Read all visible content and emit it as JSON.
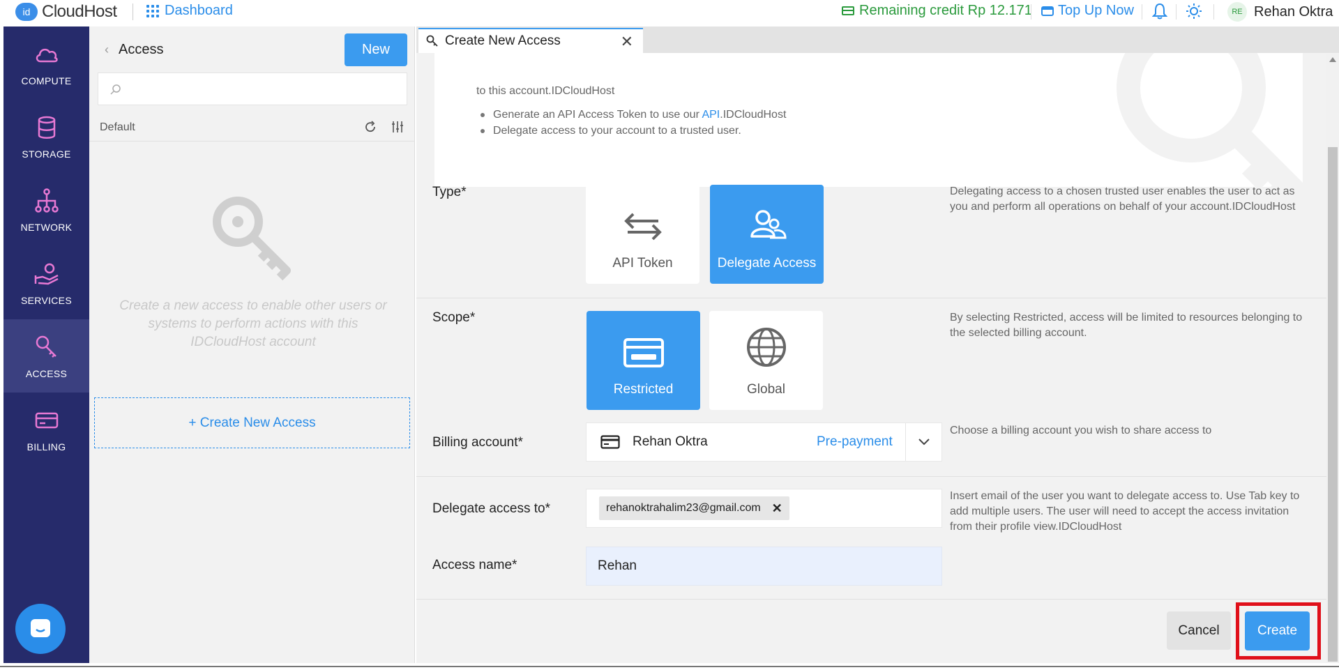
{
  "header": {
    "logo_badge": "id",
    "logo_text": "CloudHost",
    "dashboard_label": "Dashboard",
    "credit_label": "Remaining credit Rp 12.171",
    "topup_label": "Top Up Now",
    "user_initials": "RE",
    "user_name": "Rehan Oktra"
  },
  "sidebar": {
    "items": [
      {
        "label": "COMPUTE",
        "icon": "cloud-icon"
      },
      {
        "label": "STORAGE",
        "icon": "database-icon"
      },
      {
        "label": "NETWORK",
        "icon": "network-icon"
      },
      {
        "label": "SERVICES",
        "icon": "services-icon"
      },
      {
        "label": "ACCESS",
        "icon": "key-icon",
        "active": true
      },
      {
        "label": "BILLING",
        "icon": "card-icon"
      }
    ]
  },
  "left_panel": {
    "title": "Access",
    "new_button": "New",
    "search_placeholder": "",
    "group_label": "Default",
    "empty_text": "Create a new access to enable other users or systems to perform actions with this IDCloudHost account",
    "create_link": "+ Create New Access"
  },
  "tab": {
    "title": "Create New Access"
  },
  "info": {
    "line1": "to this account.IDCloudHost",
    "bullet1_prefix": "Generate an API Access Token to use our ",
    "bullet1_link": "API",
    "bullet1_suffix": ".IDCloudHost",
    "bullet2": "Delegate access to your account to a trusted user."
  },
  "form": {
    "type_label": "Type*",
    "type_options": [
      "API Token",
      "Delegate Access"
    ],
    "type_selected": "Delegate Access",
    "type_help": "Delegating access to a chosen trusted user enables the user to act as you and perform all operations on behalf of your account.IDCloudHost",
    "scope_label": "Scope*",
    "scope_options": [
      "Restricted",
      "Global"
    ],
    "scope_selected": "Restricted",
    "scope_help": "By selecting Restricted, access will be limited to resources belonging to the selected billing account.",
    "billing_label": "Billing account*",
    "billing_name": "Rehan Oktra",
    "billing_type": "Pre-payment",
    "billing_help": "Choose a billing account you wish to share access to",
    "delegate_label": "Delegate access to*",
    "delegate_email": "rehanoktrahalim23@gmail.com",
    "delegate_help": "Insert email of the user you want to delegate access to. Use Tab key to add multiple users. The user will need to accept the access invitation from their profile view.IDCloudHost",
    "access_name_label": "Access name*",
    "access_name_value": "Rehan"
  },
  "actions": {
    "cancel": "Cancel",
    "create": "Create"
  },
  "colors": {
    "accent": "#3b9bef",
    "sidebar": "#262b6b",
    "credit": "#2a9a3c",
    "highlight": "#e0101a"
  }
}
